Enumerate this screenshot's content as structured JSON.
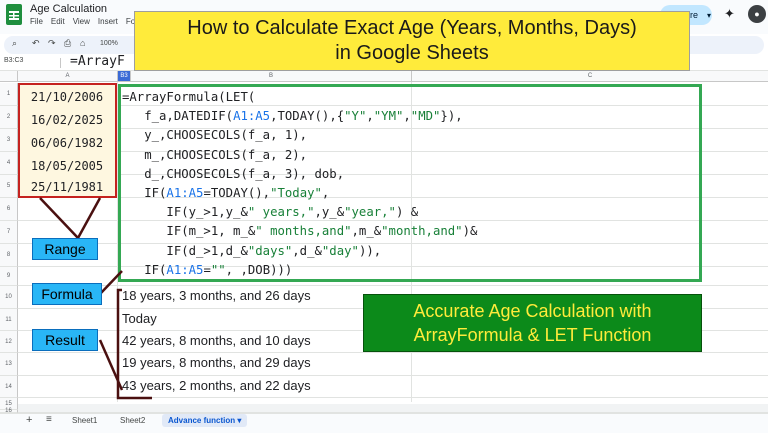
{
  "window": {
    "title": "Age Calculation",
    "share_label": "Share"
  },
  "menu": [
    "File",
    "Edit",
    "View",
    "Insert",
    "Fo"
  ],
  "toolbar": {
    "zoom": "100%"
  },
  "formula_bar": {
    "name_box": "B3:C3",
    "formula": "=ArrayF"
  },
  "columns": [
    "A",
    "B",
    "C"
  ],
  "selected_column": "B3",
  "rows": [
    "1",
    "2",
    "3",
    "4",
    "5",
    "6",
    "7",
    "8",
    "9",
    "10",
    "11",
    "12",
    "13",
    "14",
    "15",
    "16"
  ],
  "dates": [
    "21/10/2006",
    "16/02/2025",
    "06/06/1982",
    "18/05/2005",
    "25/11/1981"
  ],
  "formula_lines": [
    "=ArrayFormula(LET(",
    "   f_a,DATEDIF(A1:A5,TODAY(),{\"Y\",\"YM\",\"MD\"}),",
    "   y_,CHOOSECOLS(f_a, 1),",
    "   m_,CHOOSECOLS(f_a, 2),",
    "   d_,CHOOSECOLS(f_a, 3), dob,",
    "   IF(A1:A5=TODAY(),\"Today\",",
    "      IF(y_>1,y_&\" years,\",y_&\"year,\") &",
    "      IF(m_>1, m_&\" months,and\",m_&\"month,and\")&",
    "      IF(d_>1,d_&\"days\",d_&\"day\")),",
    "   IF(A1:A5=\"\", ,DOB)))"
  ],
  "results": [
    "18 years, 3 months, and 26 days",
    "Today",
    "42 years, 8 months, and 10 days",
    "19 years, 8 months, and 29 days",
    "43 years, 2 months, and 22 days"
  ],
  "banner": {
    "line1": "How to Calculate Exact Age (Years, Months, Days)",
    "line2": "in Google Sheets"
  },
  "callouts": {
    "range": "Range",
    "formula": "Formula",
    "result": "Result"
  },
  "green_banner": {
    "line1": "Accurate Age Calculation with",
    "line2": "ArrayFormula & LET Function"
  },
  "sheets": [
    "Sheet1",
    "Sheet2",
    "Advance function"
  ],
  "colors": {
    "accent": "#ffeb3b",
    "green": "#0c8a1a",
    "callout": "#29b6f6",
    "arrow": "#4a1010"
  }
}
